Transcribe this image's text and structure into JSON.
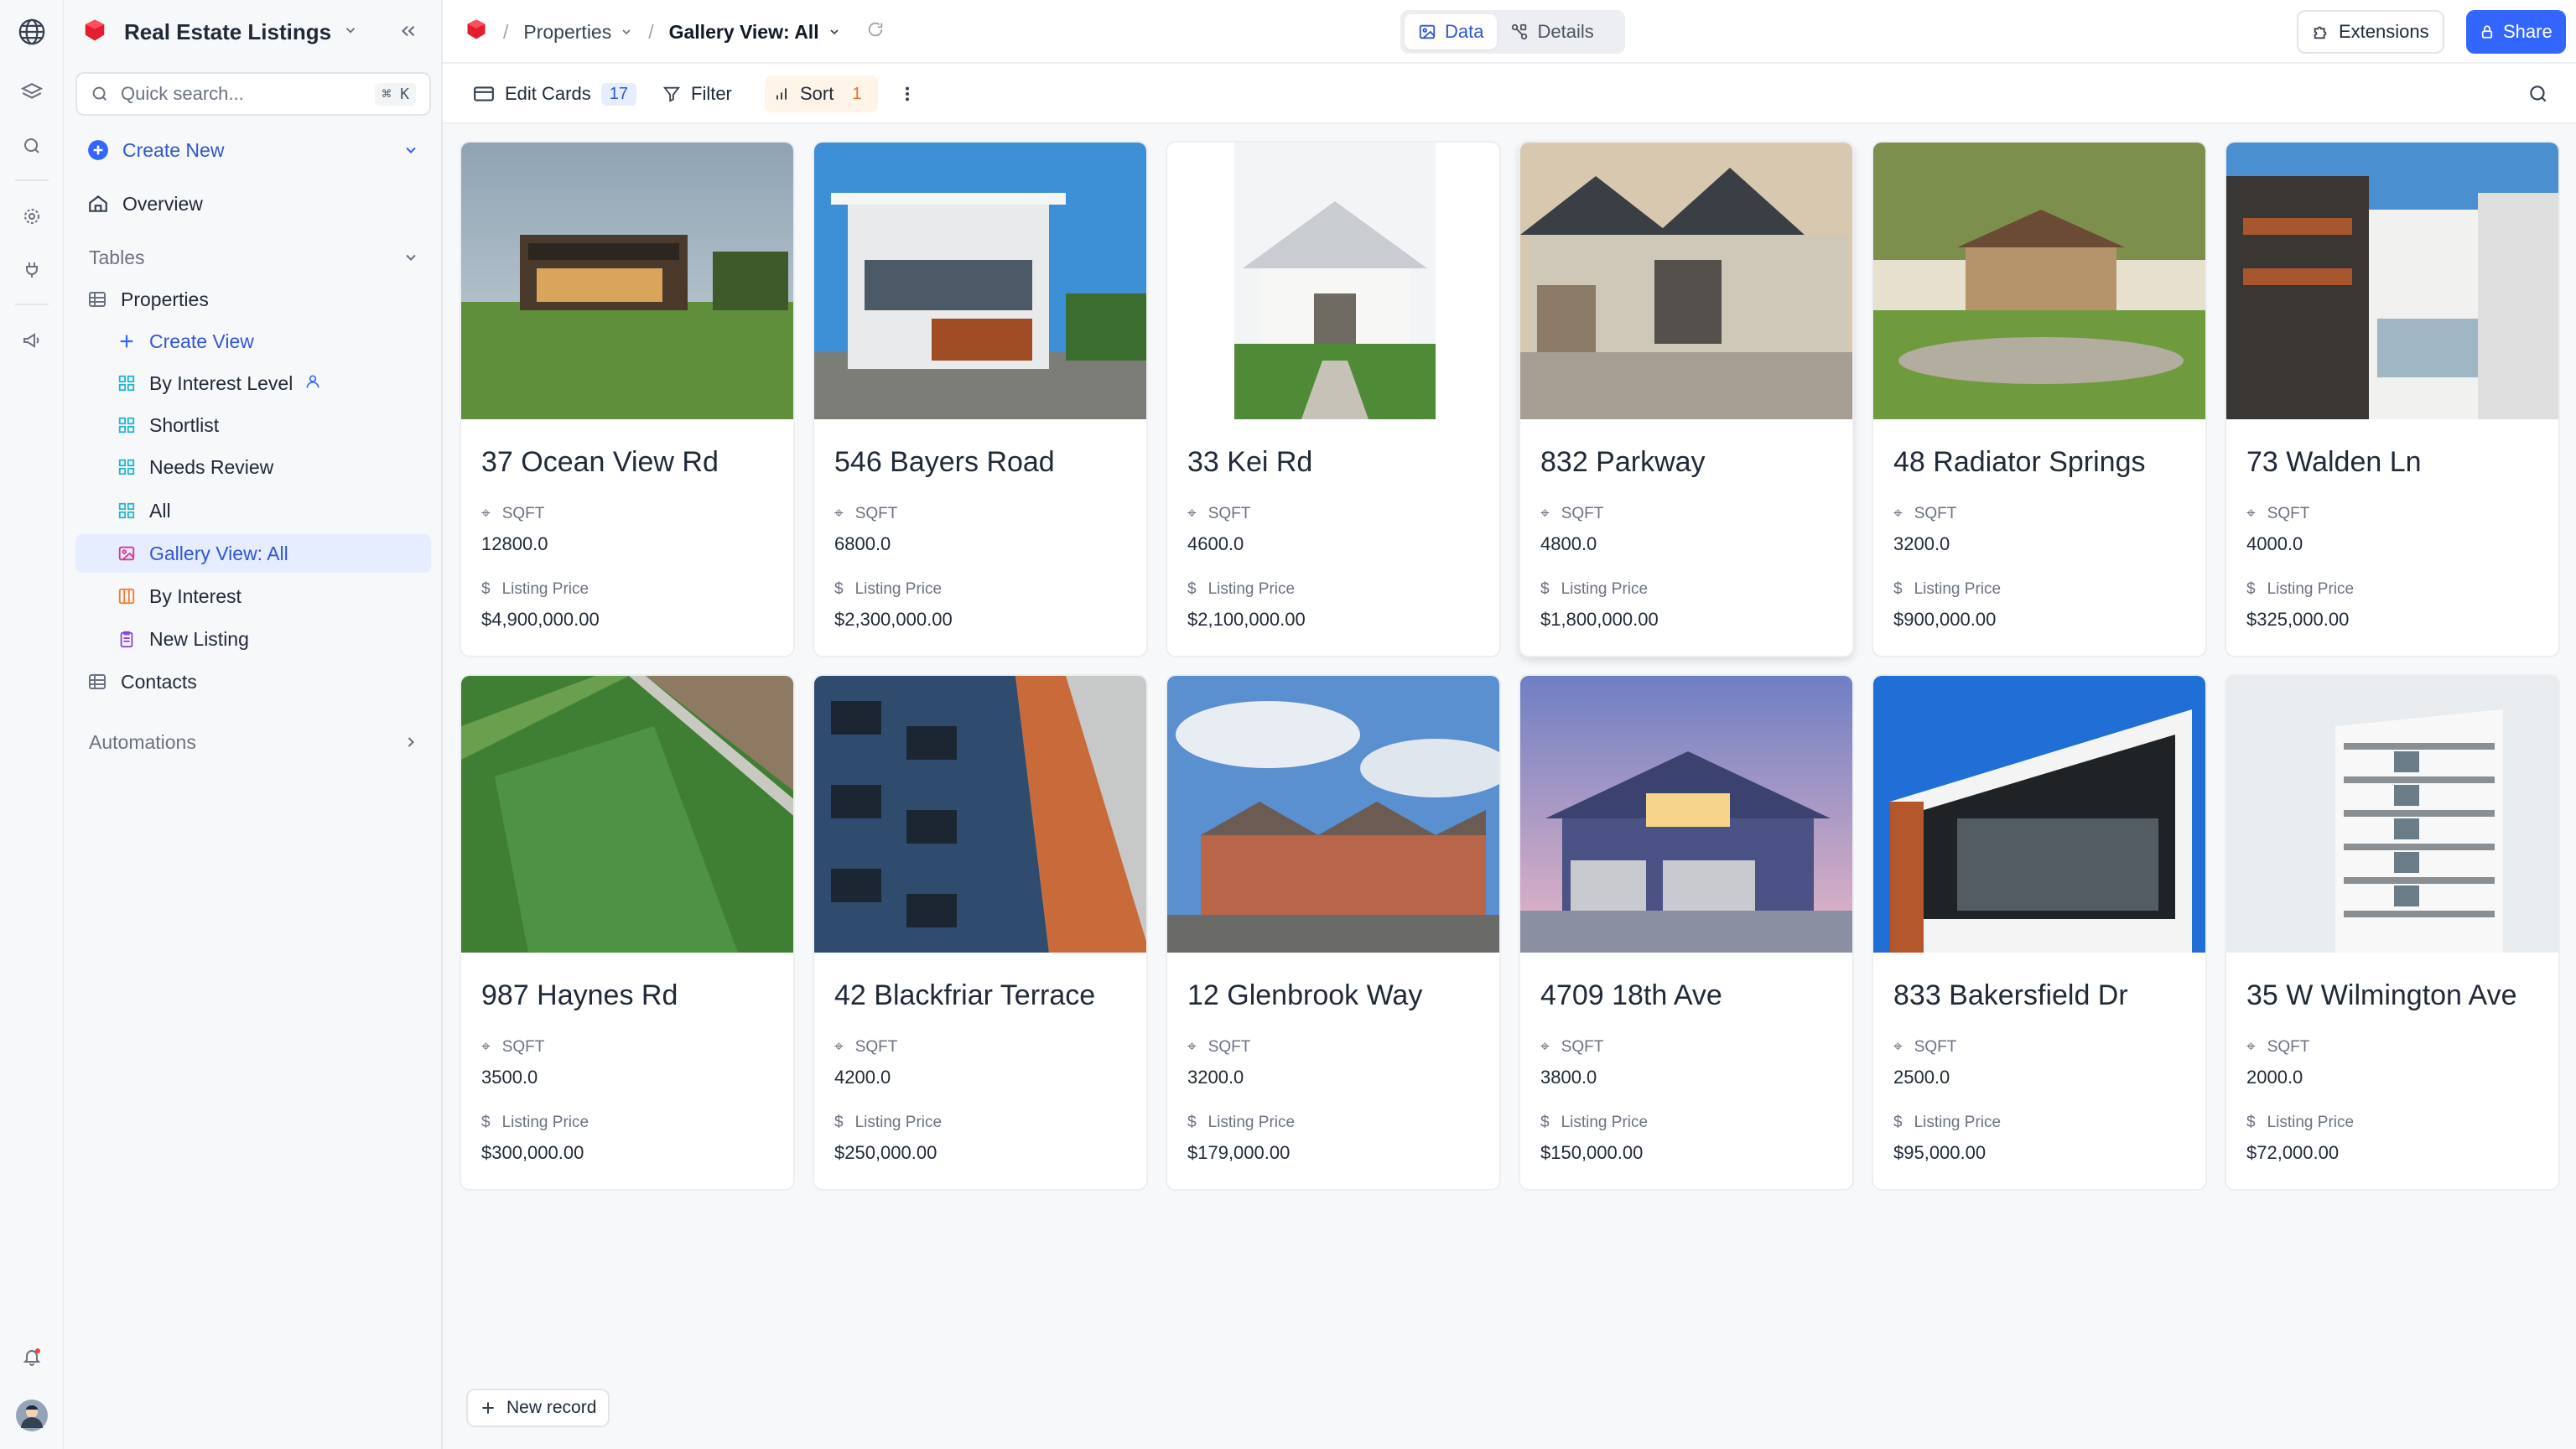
{
  "base": {
    "title": "Real Estate Listings"
  },
  "sidebar": {
    "search_placeholder": "Quick search...",
    "search_shortcut": "⌘ K",
    "create_new": "Create New",
    "overview": "Overview",
    "tables_label": "Tables",
    "tables": [
      {
        "label": "Properties"
      },
      {
        "label": "Contacts"
      }
    ],
    "views": [
      {
        "label": "Create View"
      },
      {
        "label": "By Interest Level"
      },
      {
        "label": "Shortlist"
      },
      {
        "label": "Needs Review"
      },
      {
        "label": "All"
      },
      {
        "label": "Gallery View: All"
      },
      {
        "label": "By Interest"
      },
      {
        "label": "New Listing"
      }
    ],
    "automations": "Automations"
  },
  "topbar": {
    "crumb_table": "Properties",
    "crumb_view": "Gallery View: All",
    "tab_data": "Data",
    "tab_details": "Details",
    "extensions": "Extensions",
    "share": "Share"
  },
  "toolbar": {
    "edit_cards": "Edit Cards",
    "edit_cards_count": "17",
    "filter": "Filter",
    "sort": "Sort",
    "sort_count": "1"
  },
  "field_labels": {
    "sqft": "SQFT",
    "price": "Listing Price"
  },
  "cards": [
    {
      "title": "37 Ocean View Rd",
      "sqft": "12800.0",
      "price": "$4,900,000.00"
    },
    {
      "title": "546 Bayers Road",
      "sqft": "6800.0",
      "price": "$2,300,000.00"
    },
    {
      "title": "33 Kei Rd",
      "sqft": "4600.0",
      "price": "$2,100,000.00"
    },
    {
      "title": "832 Parkway",
      "sqft": "4800.0",
      "price": "$1,800,000.00"
    },
    {
      "title": "48 Radiator Springs",
      "sqft": "3200.0",
      "price": "$900,000.00"
    },
    {
      "title": "73 Walden Ln",
      "sqft": "4000.0",
      "price": "$325,000.00"
    },
    {
      "title": "987 Haynes Rd",
      "sqft": "3500.0",
      "price": "$300,000.00"
    },
    {
      "title": "42 Blackfriar Terrace",
      "sqft": "4200.0",
      "price": "$250,000.00"
    },
    {
      "title": "12 Glenbrook Way",
      "sqft": "3200.0",
      "price": "$179,000.00"
    },
    {
      "title": "4709 18th Ave",
      "sqft": "3800.0",
      "price": "$150,000.00"
    },
    {
      "title": "833 Bakersfield Dr",
      "sqft": "2500.0",
      "price": "$95,000.00"
    },
    {
      "title": "35 W Wilmington Ave",
      "sqft": "2000.0",
      "price": "$72,000.00"
    }
  ],
  "new_record": "New record",
  "colors": {
    "accent": "#3366ff",
    "active_bg": "#e5edff",
    "sort_bg": "#fff4e8"
  }
}
